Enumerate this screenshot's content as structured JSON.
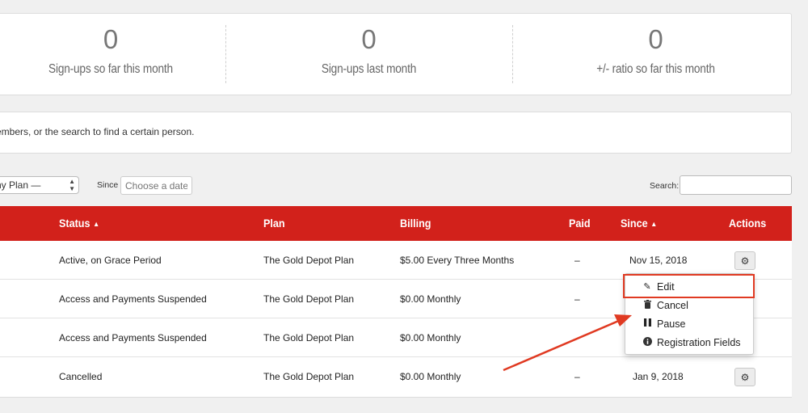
{
  "stats": [
    {
      "value": "0",
      "label": "Sign-ups so far this month"
    },
    {
      "value": "0",
      "label": "Sign-ups last month"
    },
    {
      "value": "0",
      "label": "+/- ratio so far this month"
    }
  ],
  "info": {
    "text": "embers, or the search to find a certain person."
  },
  "filters": {
    "plan_select": "ny Plan —",
    "since_label": "Since",
    "date_placeholder": "Choose a date",
    "search_label": "Search:"
  },
  "table": {
    "columns": {
      "status": "Status",
      "plan": "Plan",
      "billing": "Billing",
      "paid": "Paid",
      "since": "Since",
      "actions": "Actions"
    },
    "rows": [
      {
        "status": "Active, on Grace Period",
        "plan": "The Gold Depot Plan",
        "billing": "$5.00 Every Three Months",
        "paid": "–",
        "since": "Nov 15, 2018"
      },
      {
        "status": "Access and Payments Suspended",
        "plan": "The Gold Depot Plan",
        "billing": "$0.00 Monthly",
        "paid": "–",
        "since": ""
      },
      {
        "status": "Access and Payments Suspended",
        "plan": "The Gold Depot Plan",
        "billing": "$0.00 Monthly",
        "paid": "",
        "since": ""
      },
      {
        "status": "Cancelled",
        "plan": "The Gold Depot Plan",
        "billing": "$0.00 Monthly",
        "paid": "–",
        "since": "Jan 9, 2018"
      }
    ]
  },
  "actions_menu": {
    "items": [
      {
        "label": "Edit",
        "icon": "pencil-icon"
      },
      {
        "label": "Cancel",
        "icon": "trash-icon"
      },
      {
        "label": "Pause",
        "icon": "pause-icon"
      },
      {
        "label": "Registration Fields",
        "icon": "info-icon"
      }
    ]
  },
  "colors": {
    "header_red": "#d2211b",
    "annotation_red": "#e03a22"
  }
}
